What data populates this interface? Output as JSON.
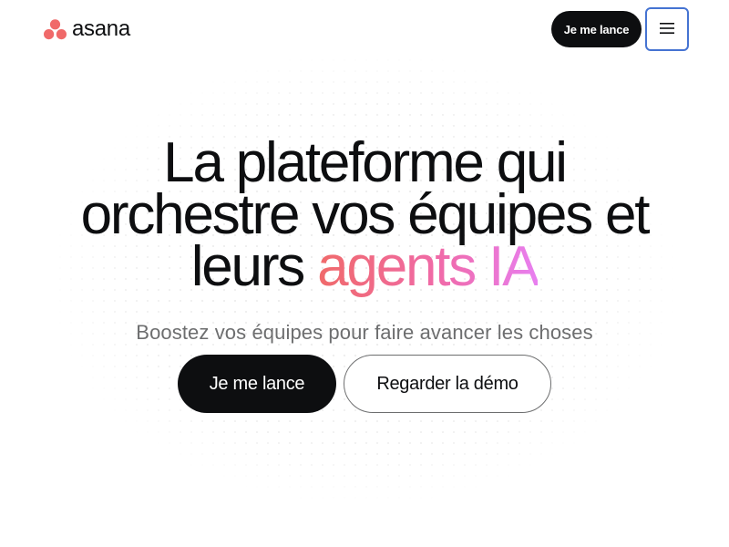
{
  "header": {
    "logo_text": "asana",
    "cta_label": "Je me lance",
    "menu_icon": "hamburger-menu-icon"
  },
  "hero": {
    "headline_line1": "La plateforme qui",
    "headline_line2": "orchestre vos équipes et",
    "headline_line3_prefix": "leurs",
    "headline_accent": "agents IA",
    "subtitle": "Boostez vos équipes pour faire avancer les choses",
    "primary_cta": "Je me lance",
    "secondary_cta": "Regarder la démo"
  },
  "colors": {
    "brand_coral": "#f06a6a",
    "accent_pink": "#f06aa8",
    "text_dark": "#0d0e10",
    "text_muted": "#6d6e6f",
    "focus_blue": "#4573d2"
  }
}
